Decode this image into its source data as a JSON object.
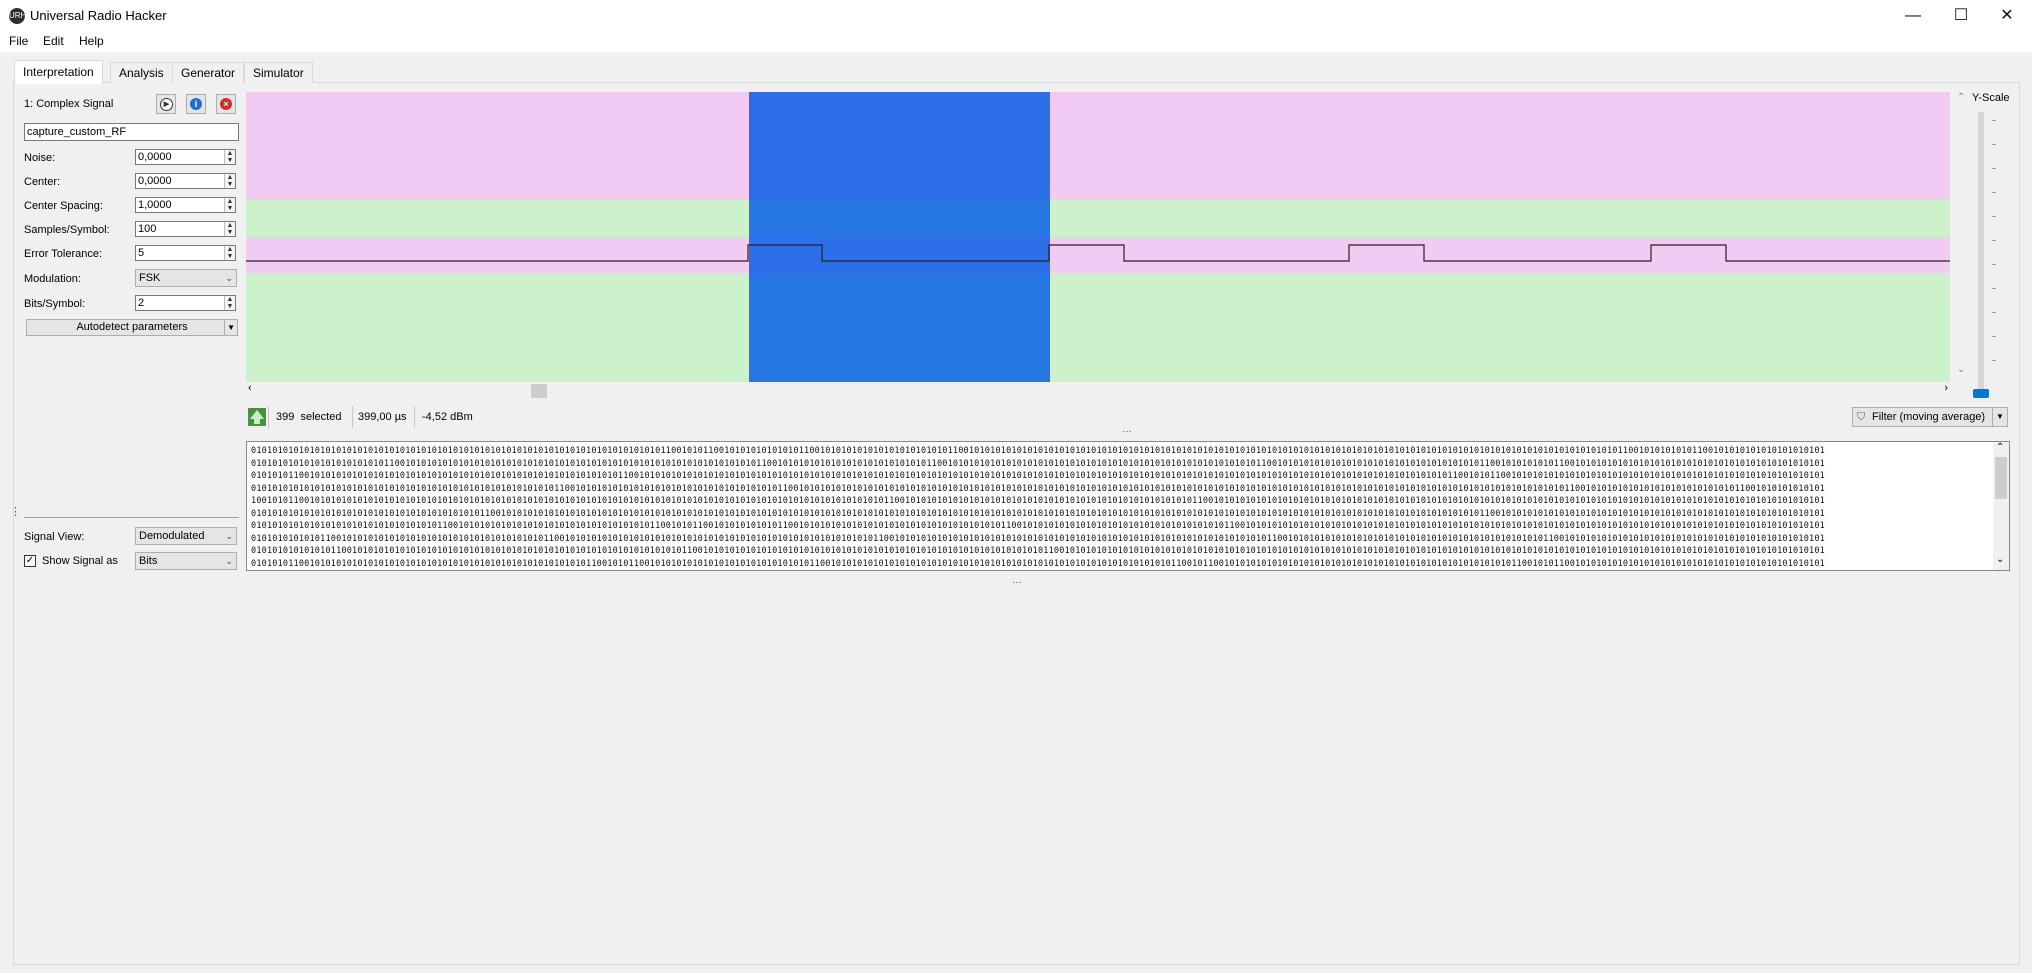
{
  "window": {
    "title": "Universal Radio Hacker",
    "icon_text": "URH",
    "controls": {
      "minimize": "—",
      "maximize": "☐",
      "close": "✕"
    }
  },
  "menu": [
    "File",
    "Edit",
    "Help"
  ],
  "tabs": [
    {
      "label": "Interpretation",
      "active": true
    },
    {
      "label": "Analysis",
      "active": false
    },
    {
      "label": "Generator",
      "active": false
    },
    {
      "label": "Simulator",
      "active": false
    }
  ],
  "signal": {
    "header": "1:  Complex Signal",
    "name": "capture_custom_RF",
    "params": {
      "noise_label": "Noise:",
      "noise": "0,0000",
      "center_label": "Center:",
      "center": "0,0000",
      "spacing_label": "Center Spacing:",
      "spacing": "1,0000",
      "sps_label": "Samples/Symbol:",
      "sps": "100",
      "tolerance_label": "Error Tolerance:",
      "tolerance": "5",
      "modulation_label": "Modulation:",
      "modulation": "FSK",
      "bits_label": "Bits/Symbol:",
      "bits": "2"
    },
    "autodetect": "Autodetect parameters",
    "signal_view_label": "Signal View:",
    "signal_view": "Demodulated",
    "show_signal_label": "Show Signal as",
    "show_signal": "Bits"
  },
  "status": {
    "selected_count": "399",
    "selected_label": "selected",
    "duration": "399,00 µs",
    "power": "-4,52 dBm"
  },
  "filter_button": "Filter (moving average)",
  "yscale_label": "Y-Scale",
  "colors": {
    "pink": "#f1cbf2",
    "green": "#cbf2cb",
    "selection": "#1560e0"
  },
  "bits_lines": [
    "01010101010101010101010101010101010101010101010101010101010101010101010101010110010101100101010101010101100101010101010101010101010110010101010101010101010101010101010101010101010101010101010101010101010101010101010101010101010101010101010101010101010101010110010101010101100101010101010101010101",
    "01010101010101010101010101100101010101010101010101010101010101010101010101010101010101010101010110010101010101010101010101010101100101010101010101010101010101010101010101010101010101010101011001010101010101010101010101010101010101011001010101010110010101010101010101010101010101010101010101010101",
    "01010101100101010101010101010101010101010101010101010101010101010101011001010101010101010101010101010101010101010101010101010101010101010101010101010101010101010101010101010101010101010101010101010101010101010101010101010101011001010110010101010101010101010101010101010101010101010101010101010101",
    "01010101010101010101010101010101010101010101010101010101011001010101010101010101010101010101010101011001010101010101010101010101010101010101010101010101010101010101010101010101010101010101010101010101010101010101010101010101010101010101010101010101100101010101010101010101010101011001010101010101",
    "10010101100101010101010101010101010101010101010101010101010101010101010101010101010101010101010101010101010101010101010110010101010101010101010101010101010101010101010101010101011001010101010101010101010101010101010101010101010101010101010101010101010101010101010101010101010101010101010101010101",
    "01010101010101010101010101010101010101010101100101010101010101010101010101010101010101010101010101010101010101010101010101010101010101010101010101010101010101010101010101010101010101010101010101010101010101010101010101010101010101011001010101010101010101010101010101010101010101010101010101010101",
    "01010101010101010101010101010101010110010101010101010101010101010101010101011001010110010101010101011001010101010101010101010101010101010101011001010101010101010101010101010101010101011001010101010101010101010101010101010101010101010101010101010101010101010101010101010101010101010101010101010101",
    "01010101010101100101010101010101010101010101010101010101100101010101010101010101010101010101010101010101010101010101011001010101010101010101010101010101010101010101010101010101010101010101010110010101010101010101010101010101010101010101010101011001010101010101010101010101010101010101010101010101",
    "01010101010101011001010101010101010101010101010101010101010101010101010101010101011001010101010101010101010101010101010101010101010101010101010101010110010101010101010101010101010101010101010101010101010101010101010101010101010101010101010101010101010101010101010101010101010101010101010101010101",
    "01010101100101010101010101010101010101010101010101010101010101011001010110010101010101010101010101010101011001010101010101010101010101010101010101010101010101010101010101010110010110010101010101010101010101010101010101010101010101010101011001010110010101010101010101010101010101010101010101010101"
  ]
}
